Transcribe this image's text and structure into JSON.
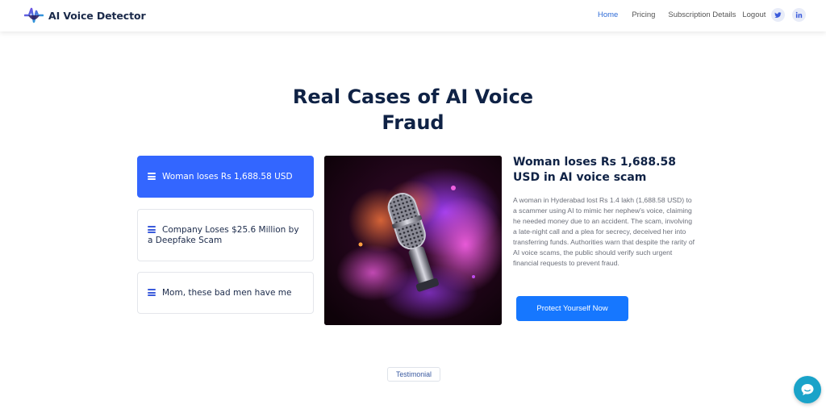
{
  "brand": {
    "name": "AI Voice Detector"
  },
  "nav": {
    "links": [
      "Home",
      "Pricing",
      "Subscription Details",
      "Logout"
    ],
    "active": "Home",
    "social": [
      "twitter-icon",
      "linkedin-icon"
    ]
  },
  "hero": {
    "title": "Real Cases of AI Voice Fraud"
  },
  "cases": [
    {
      "label": "Woman loses Rs 1,688.58 USD"
    },
    {
      "label": "Company Loses $25.6 Million by a Deepfake Scam"
    },
    {
      "label": "Mom, these bad men have me"
    }
  ],
  "detail": {
    "title": "Woman loses Rs 1,688.58 USD in AI voice scam",
    "body": "A woman in Hyderabad lost Rs 1.4 lakh (1,688.58 USD) to a scammer using AI to mimic her nephew's voice, claiming he needed money due to an accident. The scam, involving a late-night call and a plea for secrecy, deceived her into transferring funds. Authorities warn that despite the rarity of AI voice scams, the public should verify such urgent financial requests to prevent fraud.",
    "cta": "Protect Yourself Now",
    "image_icon": "microphone-smoke-image"
  },
  "section_badge": "Testimonial",
  "colors": {
    "primary": "#3366ff",
    "cta": "#1677ff",
    "heading": "#0f2245",
    "chat": "#1aa3c9"
  }
}
